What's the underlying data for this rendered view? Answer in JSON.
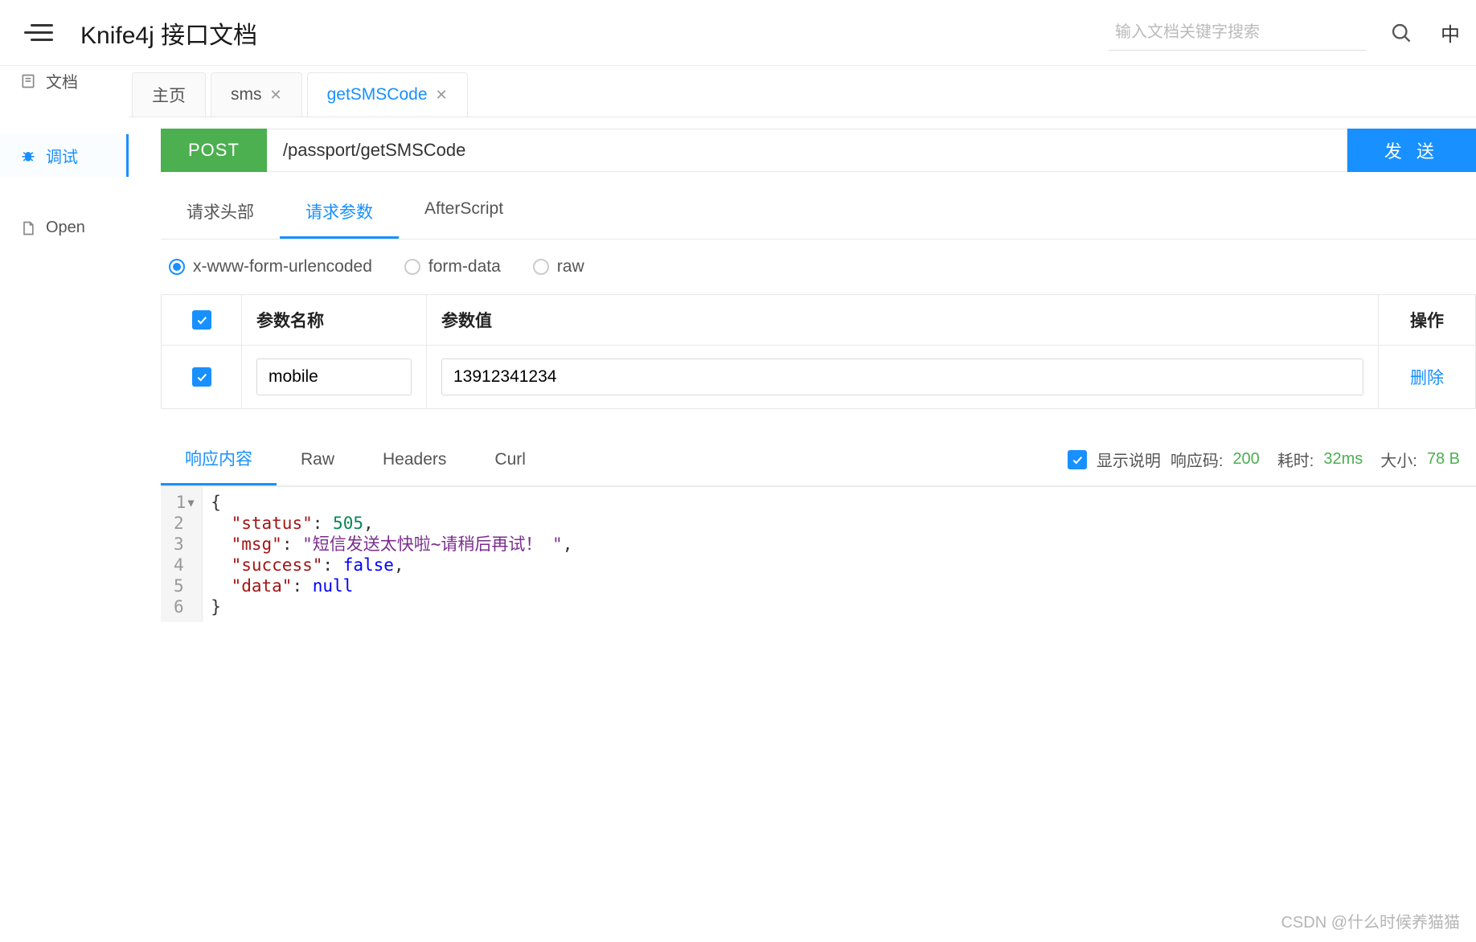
{
  "header": {
    "title": "Knife4j 接口文档",
    "search_placeholder": "输入文档关键字搜索",
    "lang": "中"
  },
  "tabs": [
    {
      "label": "主页",
      "closable": false
    },
    {
      "label": "sms",
      "closable": true
    },
    {
      "label": "getSMSCode",
      "closable": true,
      "active": true
    }
  ],
  "sidebar": {
    "doc_label": "文档",
    "debug_label": "调试",
    "open_label": "Open"
  },
  "request": {
    "method": "POST",
    "url": "/passport/getSMSCode",
    "send_label": "发 送"
  },
  "req_tabs": {
    "headers": "请求头部",
    "params": "请求参数",
    "afterscript": "AfterScript"
  },
  "body_types": {
    "urlencoded": "x-www-form-urlencoded",
    "formdata": "form-data",
    "raw": "raw"
  },
  "params_table": {
    "col_name": "参数名称",
    "col_value": "参数值",
    "col_action": "操作",
    "rows": [
      {
        "name": "mobile",
        "value": "13912341234",
        "action": "删除"
      }
    ]
  },
  "resp_tabs": {
    "body": "响应内容",
    "raw": "Raw",
    "headers": "Headers",
    "curl": "Curl"
  },
  "resp_meta": {
    "show_desc": "显示说明",
    "code_label": "响应码:",
    "code_value": "200",
    "time_label": "耗时:",
    "time_value": "32ms",
    "size_label": "大小:",
    "size_value": "78 B"
  },
  "response_json": {
    "status": 505,
    "msg": "短信发送太快啦~请稍后再试！",
    "success": false,
    "data": null
  },
  "watermark": "CSDN @什么时候养猫猫"
}
